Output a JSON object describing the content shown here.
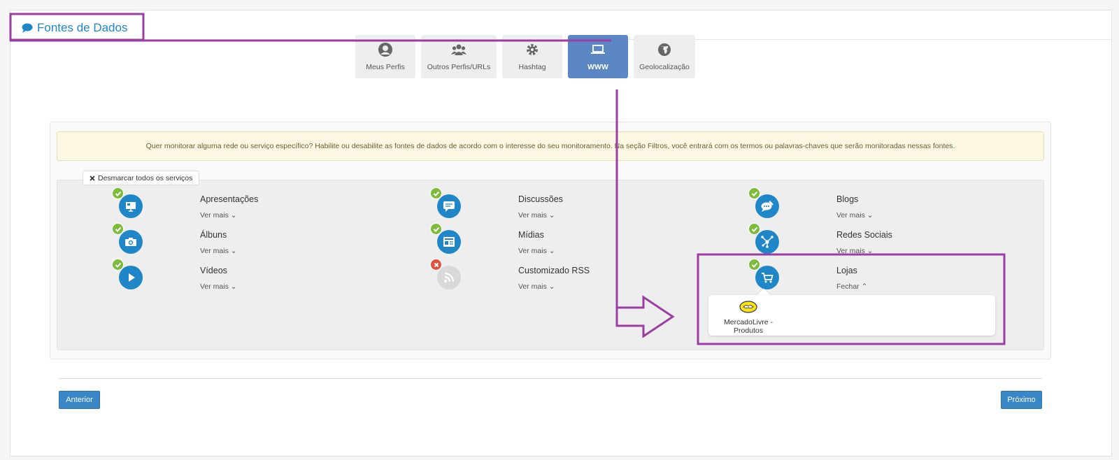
{
  "header": {
    "title": "Fontes de Dados",
    "title_icon": "speech-bubble-icon"
  },
  "tabs": [
    {
      "label": "Meus Perfis",
      "icon": "user-circle-icon",
      "active": false
    },
    {
      "label": "Outros Perfis/URLs",
      "icon": "users-icon",
      "active": false
    },
    {
      "label": "Hashtag",
      "icon": "gear-icon",
      "active": false
    },
    {
      "label": "WWW",
      "icon": "laptop-icon",
      "active": true
    },
    {
      "label": "Geolocalização",
      "icon": "globe-icon",
      "active": false
    }
  ],
  "info_message": "Quer monitorar alguma rede ou serviço específico? Habilite ou desabilite as fontes de dados de acordo com o interesse do seu monitoramento. Na seção Filtros, você entrará com os termos ou palavras-chaves que serão monitoradas nessas fontes.",
  "desmarcar_label": "Desmarcar todos os serviços",
  "services": [
    {
      "name": "Apresentações",
      "toggle": "Ver mais",
      "icon": "presentation-icon",
      "enabled": true
    },
    {
      "name": "Discussões",
      "toggle": "Ver mais",
      "icon": "chat-icon",
      "enabled": true
    },
    {
      "name": "Blogs",
      "toggle": "Ver mais",
      "icon": "blog-bubble-icon",
      "enabled": true
    },
    {
      "name": "Álbuns",
      "toggle": "Ver mais",
      "icon": "camera-icon",
      "enabled": true
    },
    {
      "name": "Mídias",
      "toggle": "Ver mais",
      "icon": "newspaper-icon",
      "enabled": true
    },
    {
      "name": "Redes Sociais",
      "toggle": "Ver mais",
      "icon": "network-icon",
      "enabled": true
    },
    {
      "name": "Vídeos",
      "toggle": "Ver mais",
      "icon": "play-icon",
      "enabled": true
    },
    {
      "name": "Customizado RSS",
      "toggle": "Ver mais",
      "icon": "rss-icon",
      "enabled": false
    },
    {
      "name": "Lojas",
      "toggle": "Fechar",
      "icon": "cart-icon",
      "enabled": true
    }
  ],
  "lojas_sources": [
    {
      "label": "MercadoLivre - Produtos",
      "icon": "mercadolivre-logo-icon"
    }
  ],
  "buttons": {
    "prev": "Anterior",
    "next": "Próximo"
  },
  "colors": {
    "accent": "#1f86c7",
    "tab_active": "#5b87c5",
    "annotation": "#9a3ea3",
    "enabled_badge": "#7dbb3a",
    "disabled_badge": "#e0533c"
  }
}
